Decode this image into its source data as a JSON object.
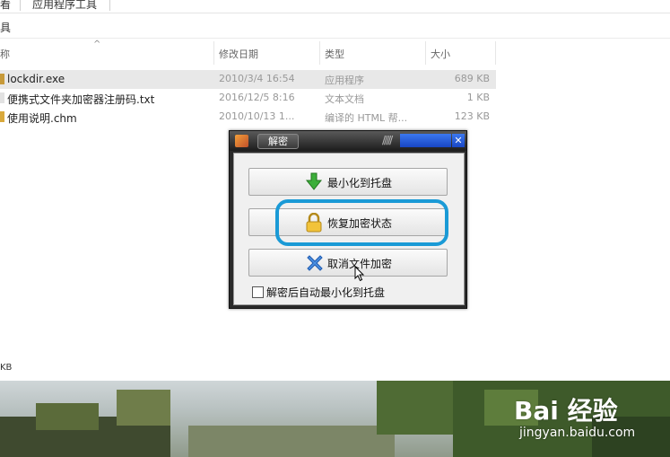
{
  "ribbon": {
    "tab_view": "看",
    "tab_app_tools": "应用程序工具"
  },
  "address": {
    "text": "具"
  },
  "columns": {
    "name": "称",
    "date": "修改日期",
    "type": "类型",
    "size": "大小"
  },
  "files": [
    {
      "name": "lockdir.exe",
      "date": "2010/3/4 16:54",
      "type": "应用程序",
      "size": "689 KB",
      "selected": true
    },
    {
      "name": "便携式文件夹加密器注册码.txt",
      "date": "2016/12/5 8:16",
      "type": "文本文档",
      "size": "1 KB"
    },
    {
      "name": "使用说明.chm",
      "date": "2010/10/13 1...",
      "type": "编译的 HTML 帮...",
      "size": "123 KB"
    }
  ],
  "status_bar": {
    "text": "KB"
  },
  "dialog": {
    "title": "解密",
    "minimize_to_tray": "最小化到托盘",
    "restore_encryption": "恢复加密状态",
    "cancel_file_encryption": "取消文件加密",
    "auto_minimize_checkbox": "解密后自动最小化到托盘",
    "close_glyph": "✕"
  },
  "watermark": {
    "main": "Bai 经验",
    "sub": "jingyan.baidu.com"
  },
  "colors": {
    "highlight_ring": "#1a9ad6",
    "title_blue": "#1846c4",
    "selected_row": "#e8e8e8"
  },
  "icons": [
    "green-down-arrow-icon",
    "padlock-icon",
    "blue-x-icon",
    "app-icon",
    "mouse-cursor-icon"
  ]
}
